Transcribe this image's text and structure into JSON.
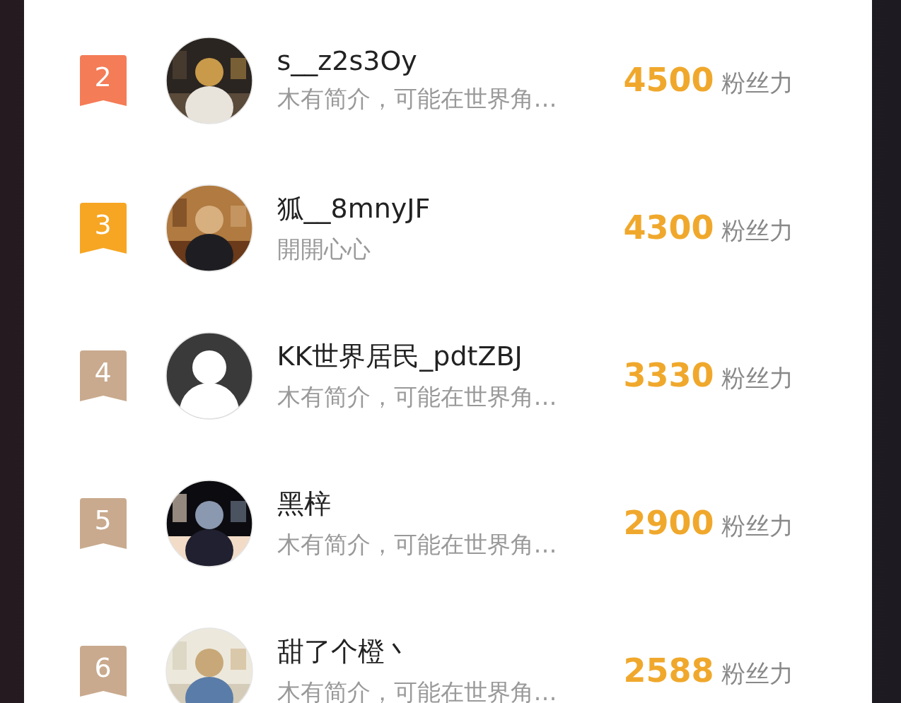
{
  "ranking": [
    {
      "rank": "2",
      "color": "#f47c57",
      "name": "s__z2s3Oy",
      "bio": "木有简介，可能在世界角…",
      "score": "4500",
      "unit": "粉丝力"
    },
    {
      "rank": "3",
      "color": "#f6a623",
      "name": "狐__8mnyJF",
      "bio": "開開心心",
      "score": "4300",
      "unit": "粉丝力"
    },
    {
      "rank": "4",
      "color": "#c9aa8e",
      "avatar": {
        "kind": "default"
      },
      "name": "KK世界居民_pdtZBJ",
      "bio": "木有简介，可能在世界角…",
      "score": "3330",
      "unit": "粉丝力"
    },
    {
      "rank": "5",
      "color": "#c9aa8e",
      "name": "黑梓",
      "bio": "木有简介，可能在世界角…",
      "score": "2900",
      "unit": "粉丝力"
    },
    {
      "rank": "6",
      "color": "#c9aa8e",
      "name": "甜了个橙丶",
      "bio": "木有简介，可能在世界角…",
      "score": "2588",
      "unit": "粉丝力"
    }
  ]
}
